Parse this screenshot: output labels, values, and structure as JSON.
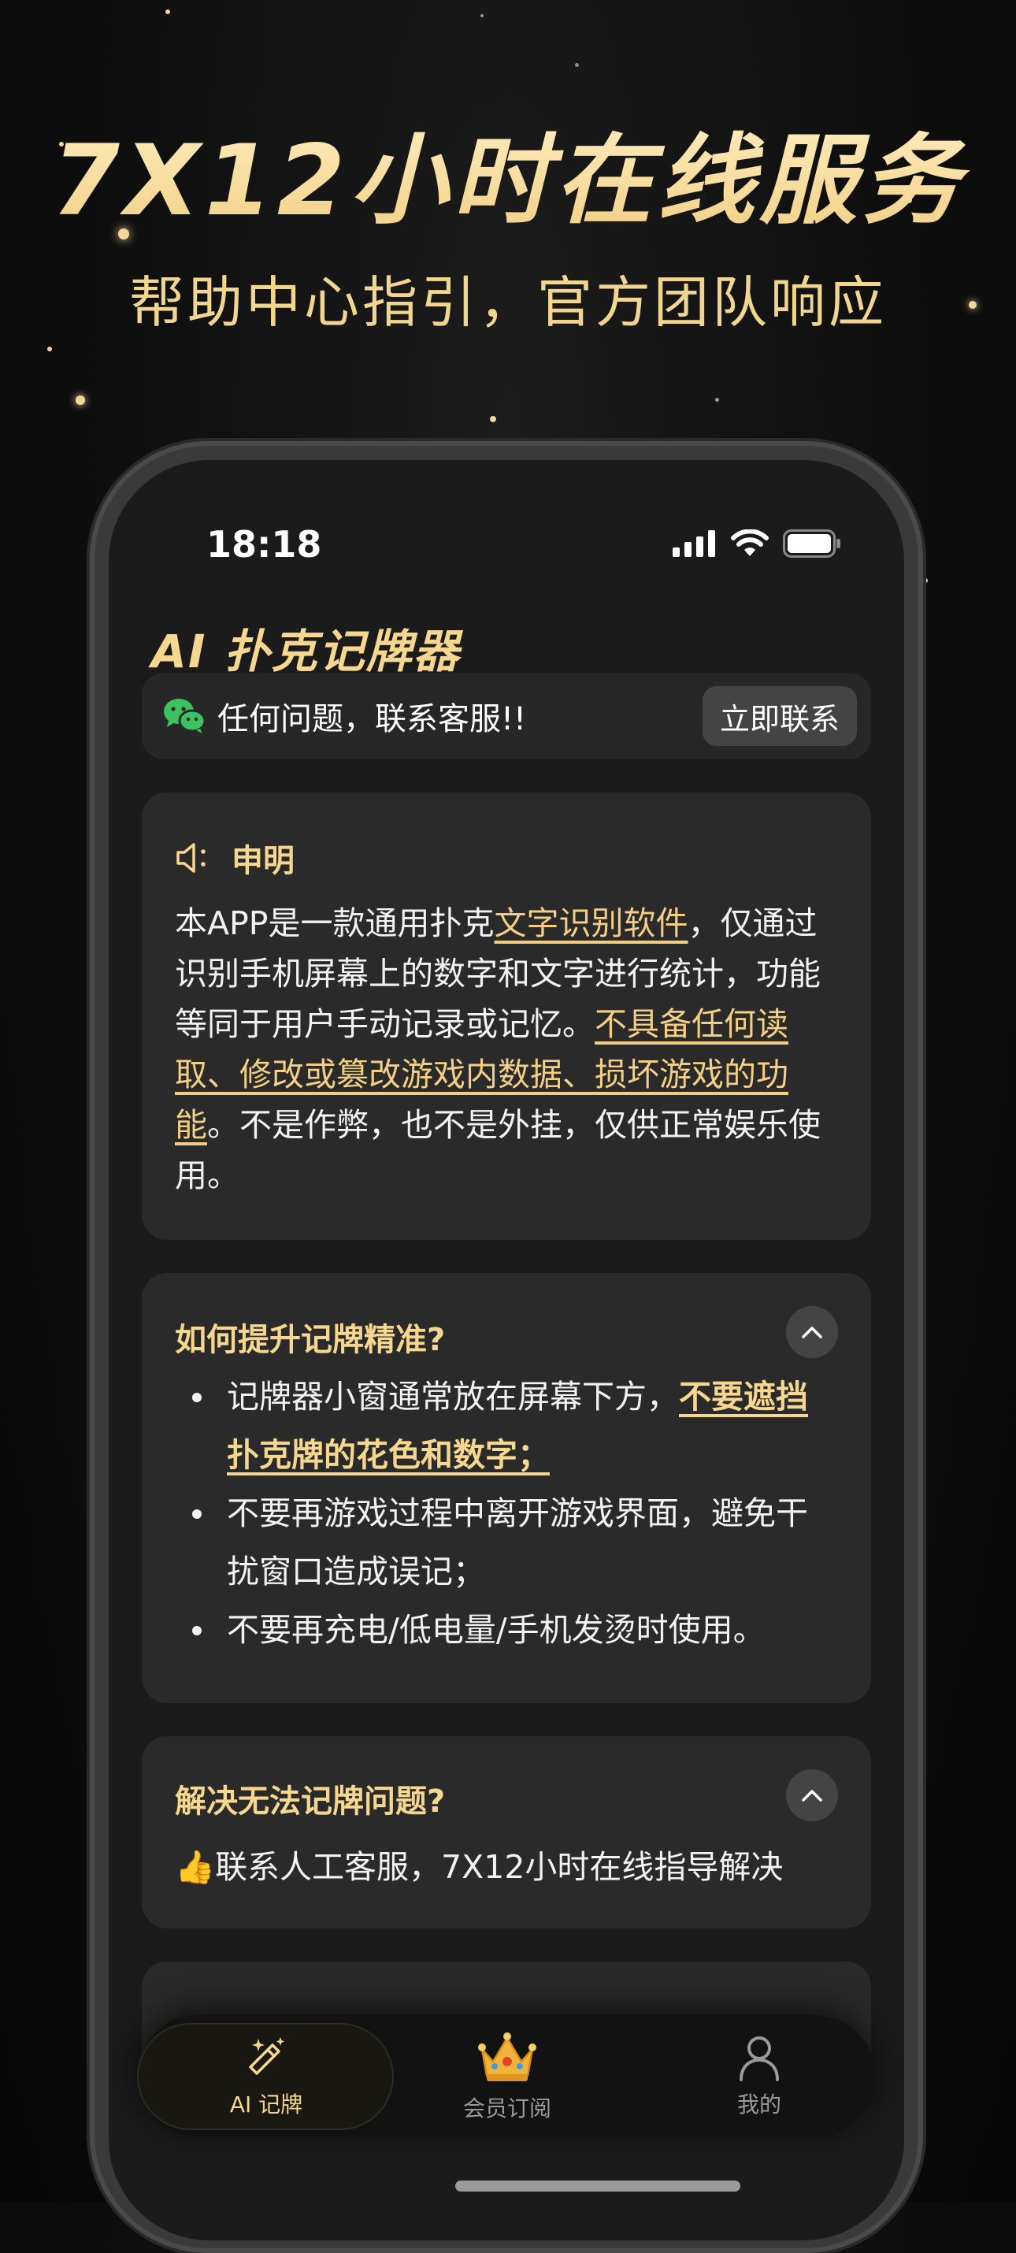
{
  "promo": {
    "headline": "7X12小时在线服务",
    "subheadline": "帮助中心指引，官方团队响应"
  },
  "status_bar": {
    "time": "18:18",
    "icons": [
      "signal-icon",
      "wifi-icon",
      "battery-icon"
    ]
  },
  "app": {
    "title": "AI 扑克记牌器"
  },
  "contact": {
    "icon": "wechat-icon",
    "text": "任何问题，联系客服!!",
    "button_label": "立即联系"
  },
  "notice": {
    "icon": "speaker-icon",
    "title": "申明",
    "p1": "本APP是一款通用扑克",
    "p1_link": "文字识别软件",
    "p2": "，仅通过识别手机屏幕上的数字和文字进行统计，功能等同于用户手动记录或记忆。",
    "p2_link": "不具备任何读取、修改或篡改游戏内数据、损坏游戏的功能",
    "p3": "。不是作弊，也不是外挂，仅供正常娱乐使用。"
  },
  "faq1": {
    "title": "如何提升记牌精准?",
    "item1_text": "记牌器小窗通常放在屏幕下方，",
    "item1_highlight": "不要遮挡扑克牌的花色和数字；",
    "item2": "不要再游戏过程中离开游戏界面，避免干扰窗口造成误记；",
    "item3": "不要再充电/低电量/手机发烫时使用。"
  },
  "faq2": {
    "title": "解决无法记牌问题?",
    "emoji": "👍",
    "answer": "联系人工客服，7X12小时在线指导解决"
  },
  "tabs": [
    {
      "label": "AI 记牌",
      "icon": "magic-wand-icon",
      "active": true
    },
    {
      "label": "会员订阅",
      "icon": "crown-icon",
      "active": false
    },
    {
      "label": "我的",
      "icon": "user-icon",
      "active": false
    }
  ],
  "colors": {
    "gold": "#f6d78f",
    "background": "#1b1b1b",
    "card": "#2a2a2a"
  }
}
